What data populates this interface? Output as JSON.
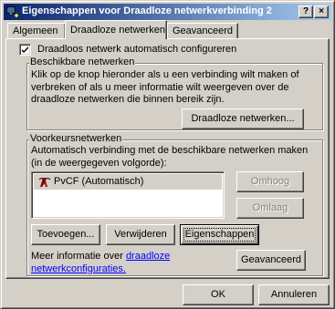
{
  "window": {
    "title": "Eigenschappen voor Draadloze netwerkverbinding 2",
    "help_glyph": "?",
    "close_glyph": "×"
  },
  "tabs": [
    {
      "label": "Algemeen",
      "active": false
    },
    {
      "label": "Draadloze netwerken",
      "active": true
    },
    {
      "label": "Geavanceerd",
      "active": false
    }
  ],
  "auto_config": {
    "label": "Draadloos netwerk automatisch configureren",
    "checked": true
  },
  "available": {
    "group_label": "Beschikbare netwerken",
    "description": [
      "Klik op de knop hieronder als u een verbinding wilt maken of",
      "verbreken of als u meer informatie wilt weergeven over de",
      "draadloze netwerken die binnen bereik zijn."
    ],
    "button": "Draadloze netwerken..."
  },
  "preferred": {
    "group_label": "Voorkeursnetwerken",
    "description": [
      "Automatisch verbinding met de beschikbare netwerken maken",
      "(in de weergegeven volgorde):"
    ],
    "networks": [
      {
        "name": "PvCF (Automatisch)",
        "icon": "wireless-network-icon"
      }
    ],
    "move_up": "Omhoog",
    "move_down": "Omlaag",
    "add": "Toevoegen...",
    "remove": "Verwijderen",
    "properties": "Eigenschappen"
  },
  "more_info": {
    "prefix": "Meer informatie over ",
    "link_line1": "draadloze",
    "link_line2": "netwerkconfiguraties."
  },
  "buttons": {
    "advanced": "Geavanceerd",
    "ok": "OK",
    "cancel": "Annuleren"
  },
  "colors": {
    "face": "#d4d0c8",
    "title_start": "#0a246a",
    "title_end": "#a6caf0",
    "link": "#0000ff"
  }
}
